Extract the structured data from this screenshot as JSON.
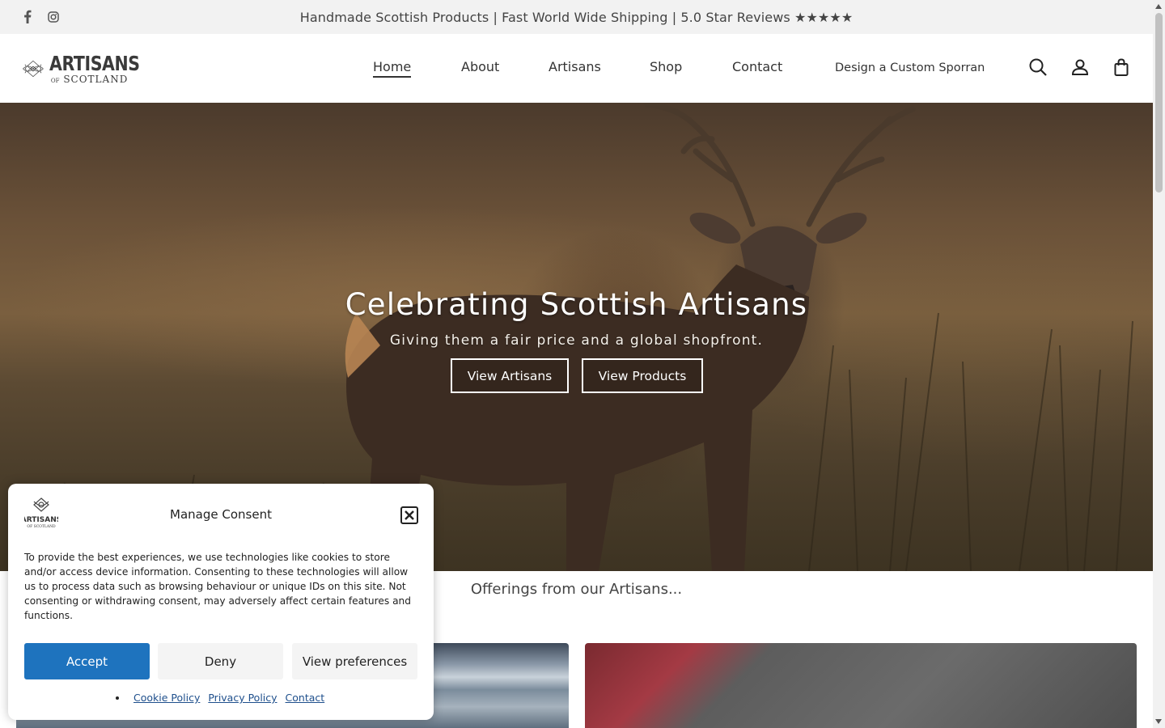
{
  "topbar": {
    "message": "Handmade Scottish Products | Fast World Wide Shipping | 5.0 Star Reviews ★★★★★",
    "social": [
      "facebook-icon",
      "instagram-icon"
    ]
  },
  "header": {
    "logo_line1": "ARTISANS",
    "logo_of": "OF",
    "logo_line2": "SCOTLAND",
    "nav": {
      "home": "Home",
      "about": "About",
      "artisans": "Artisans",
      "shop": "Shop",
      "contact": "Contact",
      "custom": "Design a Custom Sporran"
    },
    "icons": [
      "search-icon",
      "account-icon",
      "cart-icon"
    ]
  },
  "hero": {
    "title": "Celebrating Scottish Artisans",
    "subtitle": "Giving them a fair price and a global shopfront.",
    "btn_artisans": "View Artisans",
    "btn_products": "View Products"
  },
  "offerings": {
    "title": "Offerings from our Artisans..."
  },
  "consent": {
    "logo_text": "ARTISANS",
    "logo_sub": "OF SCOTLAND",
    "title": "Manage Consent",
    "body": "To provide the best experiences, we use technologies like cookies to store and/or access device information. Consenting to these technologies will allow us to process data such as browsing behaviour or unique IDs on this site. Not consenting or withdrawing consent, may adversely affect certain features and functions.",
    "accept": "Accept",
    "deny": "Deny",
    "preferences": "View preferences",
    "links": {
      "cookie": "Cookie Policy",
      "privacy": "Privacy Policy",
      "contact": "Contact"
    }
  },
  "colors": {
    "accent": "#1e73be",
    "topbar_bg": "#f2f2f2"
  }
}
